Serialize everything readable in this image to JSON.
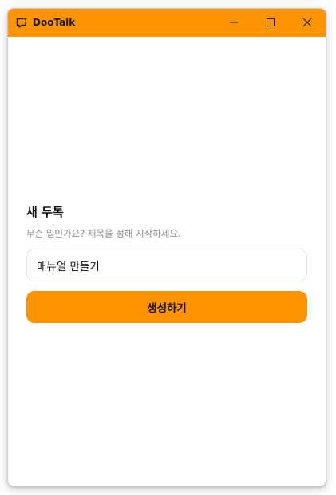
{
  "window": {
    "title": "DooTalk",
    "app_icon": "chat-bubble-sparkle-icon",
    "controls": {
      "minimize_icon": "minimize-icon",
      "maximize_icon": "maximize-icon",
      "close_icon": "close-icon"
    }
  },
  "form": {
    "heading": "새 두톡",
    "subtitle": "무슨 일인가요? 제목을 정해 시작하세요.",
    "title_input_value": "매뉴얼 만들기",
    "create_label": "생성하기"
  },
  "colors": {
    "accent": "#ff9400",
    "text": "#111111",
    "muted": "#8a8a8a",
    "border": "#e2e2e2"
  }
}
